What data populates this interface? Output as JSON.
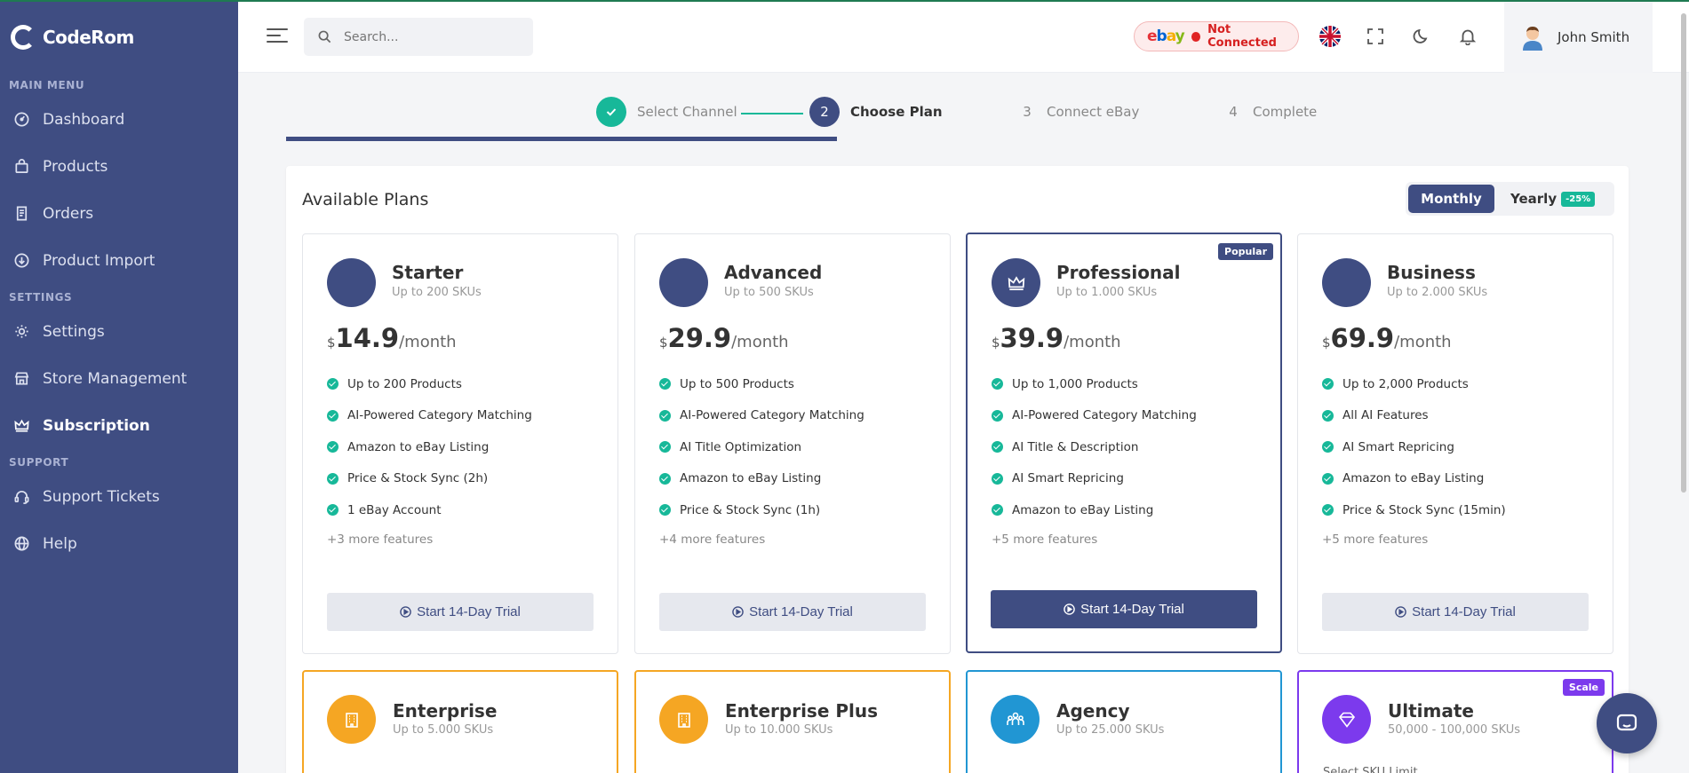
{
  "brand": {
    "name": "CodeRom"
  },
  "sidebar": {
    "sections": [
      {
        "title": "MAIN MENU",
        "items": [
          {
            "label": "Dashboard",
            "icon": "dashboard-icon"
          },
          {
            "label": "Products",
            "icon": "bag-icon"
          },
          {
            "label": "Orders",
            "icon": "receipt-icon"
          },
          {
            "label": "Product Import",
            "icon": "download-icon"
          }
        ]
      },
      {
        "title": "SETTINGS",
        "items": [
          {
            "label": "Settings",
            "icon": "gear-icon"
          },
          {
            "label": "Store Management",
            "icon": "store-icon"
          },
          {
            "label": "Subscription",
            "icon": "crown-icon",
            "active": true
          }
        ]
      },
      {
        "title": "SUPPORT",
        "items": [
          {
            "label": "Support Tickets",
            "icon": "headset-icon"
          },
          {
            "label": "Help",
            "icon": "globe-icon"
          }
        ]
      }
    ]
  },
  "header": {
    "search_placeholder": "Search...",
    "ebay_status": "Not Connected",
    "user_name": "John Smith"
  },
  "stepper": {
    "steps": [
      {
        "num": "✓",
        "label": "Select Channel",
        "state": "done"
      },
      {
        "num": "2",
        "label": "Choose Plan",
        "state": "active"
      },
      {
        "num": "3",
        "label": "Connect eBay",
        "state": "todo"
      },
      {
        "num": "4",
        "label": "Complete",
        "state": "todo"
      }
    ],
    "progress_fraction": 0.41
  },
  "plans_section": {
    "title": "Available Plans",
    "toggle": {
      "monthly": "Monthly",
      "yearly": "Yearly",
      "yearly_badge": "-25%"
    }
  },
  "plans": [
    {
      "name": "Starter",
      "sku": "Up to 200 SKUs",
      "currency": "$",
      "price": "14.9",
      "period": "/month",
      "features": [
        "Up to 200 Products",
        "AI-Powered Category Matching",
        "Amazon to eBay Listing",
        "Price & Stock Sync (2h)",
        "1 eBay Account"
      ],
      "more": "+3 more features",
      "cta": "Start 14-Day Trial"
    },
    {
      "name": "Advanced",
      "sku": "Up to 500 SKUs",
      "currency": "$",
      "price": "29.9",
      "period": "/month",
      "features": [
        "Up to 500 Products",
        "AI-Powered Category Matching",
        "AI Title Optimization",
        "Amazon to eBay Listing",
        "Price & Stock Sync (1h)"
      ],
      "more": "+4 more features",
      "cta": "Start 14-Day Trial"
    },
    {
      "name": "Professional",
      "sku": "Up to 1.000 SKUs",
      "currency": "$",
      "price": "39.9",
      "period": "/month",
      "badge": "Popular",
      "features": [
        "Up to 1,000 Products",
        "AI-Powered Category Matching",
        "AI Title & Description",
        "AI Smart Repricing",
        "Amazon to eBay Listing"
      ],
      "more": "+5 more features",
      "cta": "Start 14-Day Trial"
    },
    {
      "name": "Business",
      "sku": "Up to 2.000 SKUs",
      "currency": "$",
      "price": "69.9",
      "period": "/month",
      "features": [
        "Up to 2,000 Products",
        "All AI Features",
        "AI Smart Repricing",
        "Amazon to eBay Listing",
        "Price & Stock Sync (15min)"
      ],
      "more": "+5 more features",
      "cta": "Start 14-Day Trial"
    }
  ],
  "plans_row2": [
    {
      "name": "Enterprise",
      "sku": "Up to 5.000 SKUs",
      "color": "#f5a623",
      "icon": "building-icon"
    },
    {
      "name": "Enterprise Plus",
      "sku": "Up to 10.000 SKUs",
      "color": "#f5a623",
      "icon": "building-icon"
    },
    {
      "name": "Agency",
      "sku": "Up to 25.000 SKUs",
      "color": "#2196d3",
      "icon": "team-icon"
    },
    {
      "name": "Ultimate",
      "sku": "50,000 - 100,000 SKUs",
      "color": "#7c3aed",
      "icon": "diamond-icon",
      "badge": "Scale",
      "sub": "Select SKU Limit"
    }
  ],
  "colors": {
    "primary": "#3f4d82",
    "success": "#17b899",
    "danger": "#e02424"
  }
}
